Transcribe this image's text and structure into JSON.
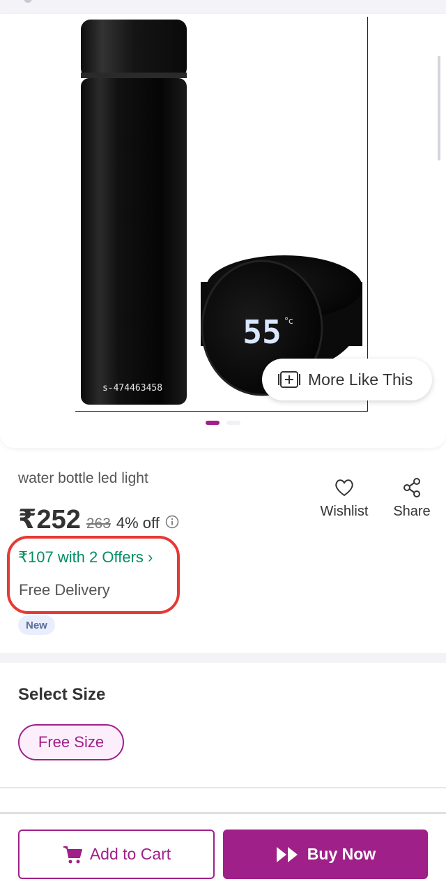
{
  "product": {
    "title": "water bottle led light",
    "image_id_text": "s-474463458",
    "display_temp": "55"
  },
  "gallery": {
    "more_like_label": "More Like This",
    "dots_count": 2,
    "active_dot": 0
  },
  "actions": {
    "wishlist_label": "Wishlist",
    "share_label": "Share"
  },
  "price": {
    "current": "₹252",
    "mrp": "263",
    "discount": "4% off"
  },
  "offers": {
    "text": "₹107 with 2 Offers ›",
    "delivery": "Free Delivery",
    "badge": "New"
  },
  "size": {
    "heading": "Select Size",
    "selected": "Free Size"
  },
  "bottom": {
    "add_to_cart": "Add to Cart",
    "buy_now": "Buy Now"
  },
  "colors": {
    "brand": "#9f2089",
    "offer_green": "#038d63",
    "highlight_red": "#e53935"
  }
}
